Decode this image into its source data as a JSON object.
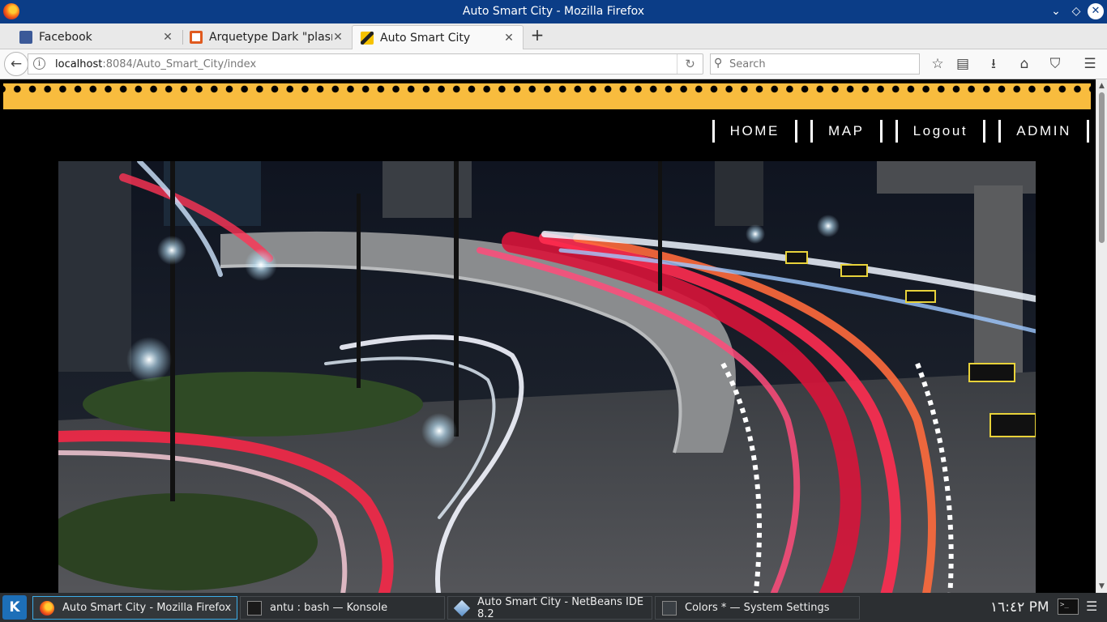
{
  "window": {
    "title": "Auto Smart City - Mozilla Firefox",
    "controls": {
      "minimize": "⌄",
      "maximize": "◇",
      "close": "✕"
    }
  },
  "tabs": [
    {
      "label": "Facebook",
      "favicon": "facebook-icon",
      "active": false
    },
    {
      "label": "Arquetype Dark \"plasm...",
      "favicon": "kde-store-icon",
      "active": false
    },
    {
      "label": "Auto Smart City",
      "favicon": "auto-smart-city-icon",
      "active": true
    }
  ],
  "new_tab_label": "+",
  "tab_close_glyph": "✕",
  "navbar": {
    "back_glyph": "←",
    "info_glyph": "i",
    "url_host": "localhost",
    "url_rest": ":8084/Auto_Smart_City/index",
    "reload_glyph": "↻",
    "search_placeholder": "Search",
    "search_glyph": "⚲",
    "toolbar_icons": [
      {
        "name": "bookmark-star-icon",
        "glyph": "☆"
      },
      {
        "name": "reading-list-icon",
        "glyph": "▤"
      },
      {
        "name": "downloads-icon",
        "glyph": "⭳"
      },
      {
        "name": "home-icon",
        "glyph": "⌂"
      },
      {
        "name": "pocket-icon",
        "glyph": "⛉"
      },
      {
        "name": "hamburger-menu-icon",
        "glyph": "☰"
      }
    ]
  },
  "site": {
    "stripe_color": "#f8bc3e",
    "nav": [
      "HOME",
      "MAP",
      "Logout",
      "ADMIN"
    ],
    "hero_description": "city-light-trails-photo"
  },
  "scrollbar": {
    "up": "▲",
    "down": "▼"
  },
  "taskbar": {
    "start_label": "K",
    "tasks": [
      {
        "label": "Auto Smart City - Mozilla Firefox",
        "icon": "firefox-icon",
        "active": true
      },
      {
        "label": "antu : bash — Konsole",
        "icon": "konsole-icon",
        "active": false
      },
      {
        "label": "Auto Smart City - NetBeans IDE 8.2",
        "icon": "netbeans-icon",
        "active": false
      },
      {
        "label": "Colors * — System Settings",
        "icon": "system-settings-icon",
        "active": false
      }
    ],
    "clock": "١٦:٤٢ PM",
    "tray_terminal_glyph": ">_",
    "tray_menu_glyph": "☰"
  },
  "colors": {
    "titlebar": "#0b3d87",
    "taskbar": "#2c2f32",
    "active_task_border": "#3daee9"
  }
}
